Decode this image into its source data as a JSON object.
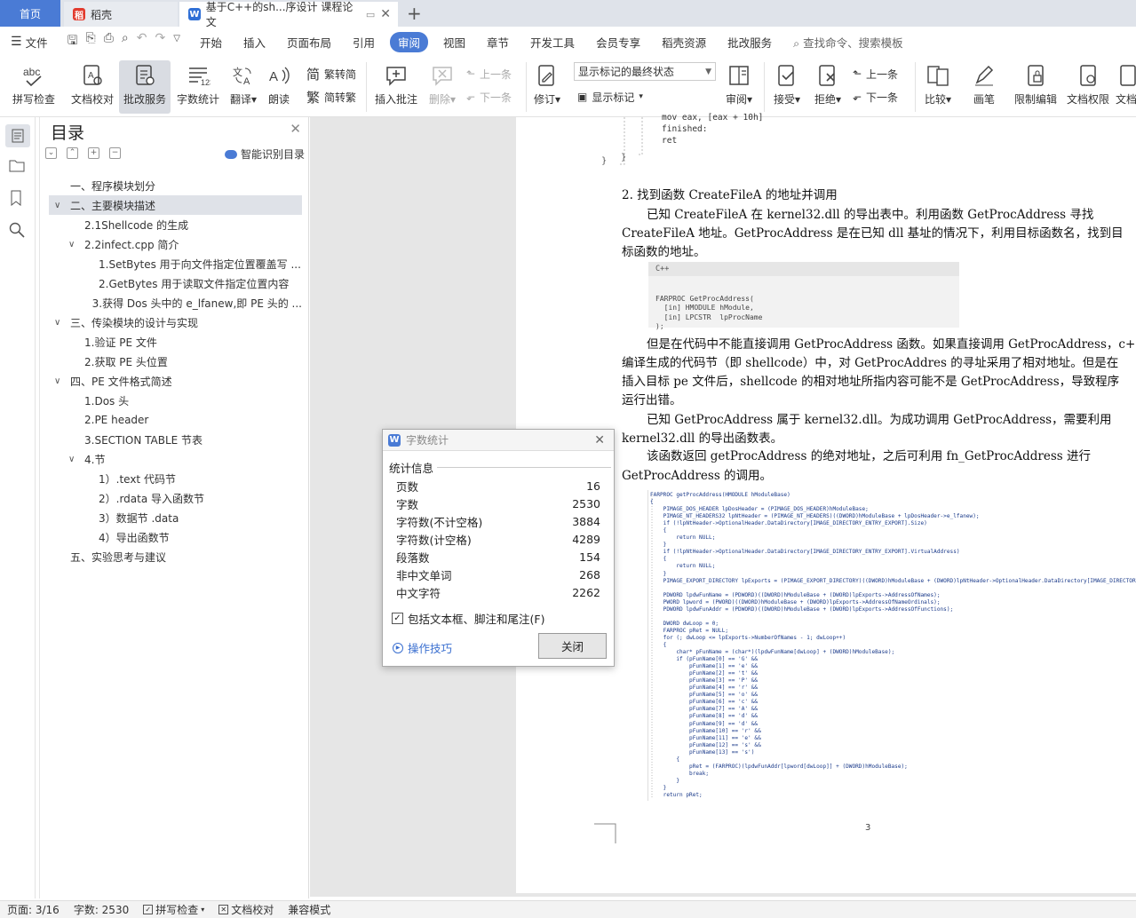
{
  "tabs": {
    "home": "首页",
    "daoke": "稻壳",
    "doc": "基于C++的sh...序设计 课程论文"
  },
  "menubar": {
    "file": "文件",
    "items": [
      "开始",
      "插入",
      "页面布局",
      "引用",
      "审阅",
      "视图",
      "章节",
      "开发工具",
      "会员专享",
      "稻壳资源",
      "批改服务"
    ],
    "search": "查找命令、搜索模板"
  },
  "ribbon": {
    "spell": "拼写检查",
    "proof": "文档校对",
    "correct": "批改服务",
    "wordcount": "字数统计",
    "translate": "翻译",
    "read": "朗读",
    "trad": "繁转简",
    "simp": "简转繁",
    "insert_comment": "插入批注",
    "delete": "删除",
    "prev": "上一条",
    "next": "下一条",
    "track": "修订",
    "markup_select": "显示标记的最终状态",
    "show_markup": "显示标记",
    "review": "审阅",
    "accept": "接受",
    "reject": "拒绝",
    "prev2": "上一条",
    "next2": "下一条",
    "compare": "比较",
    "pen": "画笔",
    "restrict": "限制编辑",
    "permission": "文档权限",
    "doc_more": "文档"
  },
  "toc": {
    "title": "目录",
    "smart": "智能识别目录",
    "items": [
      {
        "label": "一、程序模块划分",
        "level": 0
      },
      {
        "label": "二、主要模块描述",
        "level": 0
      },
      {
        "label": "2.1Shellcode 的生成",
        "level": 1
      },
      {
        "label": "2.2infect.cpp 简介",
        "level": 1
      },
      {
        "label": "1.SetBytes 用于向文件指定位置覆盖写 ...",
        "level": 2
      },
      {
        "label": "2.GetBytes 用于读取文件指定位置内容",
        "level": 2
      },
      {
        "label": "3.获得 Dos 头中的 e_lfanew,即 PE 头的 ...",
        "level": 2
      },
      {
        "label": "三、传染模块的设计与实现",
        "level": 0
      },
      {
        "label": "1.验证 PE 文件",
        "level": 1
      },
      {
        "label": "2.获取 PE 头位置",
        "level": 1
      },
      {
        "label": "四、PE 文件格式简述",
        "level": 0
      },
      {
        "label": "1.Dos 头",
        "level": 1
      },
      {
        "label": "2.PE header",
        "level": 1
      },
      {
        "label": "3.SECTION TABLE 节表",
        "level": 1
      },
      {
        "label": "4.节",
        "level": 1
      },
      {
        "label": "1）.text 代码节",
        "level": 2
      },
      {
        "label": "2）.rdata 导入函数节",
        "level": 2
      },
      {
        "label": "3）数据节 .data",
        "level": 2
      },
      {
        "label": "4）导出函数节",
        "level": 2
      },
      {
        "label": "五、实验思考与建议",
        "level": 0
      }
    ]
  },
  "document": {
    "code_top": [
      "mov eax, [eax + 10h]",
      "finished:",
      "ret"
    ],
    "heading2": "2.  找到函数 CreateFileA 的地址并调用",
    "p1": [
      "已知 CreateFileA 在 kernel32.dll 的导出表中。利用函数 GetProcAddress 寻找",
      "CreateFileA 地址。GetProcAddress 是在已知 dll 基址的情况下，利用目标函数名，找到目",
      "标函数的地址。"
    ],
    "code_lang": "C++",
    "code_block": [
      "FARPROC GetProcAddress(",
      "  [in] HMODULE hModule,",
      "  [in] LPCSTR  lpProcName",
      ");"
    ],
    "p2": [
      "但是在代码中不能直接调用 GetProcAddress 函数。如果直接调用 GetProcAddress，c++",
      "编译生成的代码节（即 shellcode）中，对 GetProcAddres 的寻址采用了相对地址。但是在",
      "插入目标 pe 文件后，shellcode 的相对地址所指内容可能不是 GetProcAddress，导致程序",
      "运行出错。"
    ],
    "p3": [
      "已知 GetProcAddress 属于 kernel32.dll。为成功调用 GetProcAddress，需要利用",
      "kernel32.dll 的导出函数表。"
    ],
    "p4": [
      "该函数返回 getProcAddress 的绝对地址，之后可利用 fn_GetProcAddress 进行",
      "GetProcAddress 的调用。"
    ],
    "code_img": [
      "FARPROC getProcAddress(HMODULE hModuleBase)",
      "{",
      "    PIMAGE_DOS_HEADER lpDosHeader = (PIMAGE_DOS_HEADER)hModuleBase;",
      "    PIMAGE_NT_HEADERS32 lpNtHeader = (PIMAGE_NT_HEADERS)((DWORD)hModuleBase + lpDosHeader->e_lfanew);",
      "    if (!lpNtHeader->OptionalHeader.DataDirectory[IMAGE_DIRECTORY_ENTRY_EXPORT].Size)",
      "    {",
      "        return NULL;",
      "    }",
      "    if (!lpNtHeader->OptionalHeader.DataDirectory[IMAGE_DIRECTORY_ENTRY_EXPORT].VirtualAddress)",
      "    {",
      "        return NULL;",
      "    }",
      "    PIMAGE_EXPORT_DIRECTORY lpExports = (PIMAGE_EXPORT_DIRECTORY)((DWORD)hModuleBase + (DWORD)lpNtHeader->OptionalHeader.DataDirectory[IMAGE_DIRECTORY_ENTRY_EXPORT].Vi",
      "",
      "    PDWORD lpdwFunName = (PDWORD)((DWORD)hModuleBase + (DWORD)lpExports->AddressOfNames);",
      "    PWORD lpword = (PWORD)((DWORD)hModuleBase + (DWORD)lpExports->AddressOfNameOrdinals);",
      "    PDWORD lpdwFunAddr = (PDWORD)((DWORD)hModuleBase + (DWORD)lpExports->AddressOfFunctions);",
      "",
      "    DWORD dwLoop = 0;",
      "    FARPROC pRet = NULL;",
      "    for (; dwLoop <= lpExports->NumberOfNames - 1; dwLoop++)",
      "    {",
      "        char* pFunName = (char*)(lpdwFunName[dwLoop] + (DWORD)hModuleBase);",
      "        if (pFunName[0] == 'G' &&",
      "            pFunName[1] == 'e' &&",
      "            pFunName[2] == 't' &&",
      "            pFunName[3] == 'P' &&",
      "            pFunName[4] == 'r' &&",
      "            pFunName[5] == 'o' &&",
      "            pFunName[6] == 'c' &&",
      "            pFunName[7] == 'A' &&",
      "            pFunName[8] == 'd' &&",
      "            pFunName[9] == 'd' &&",
      "            pFunName[10] == 'r' &&",
      "            pFunName[11] == 'e' &&",
      "            pFunName[12] == 's' &&",
      "            pFunName[13] == 's')",
      "        {",
      "            pRet = (FARPROC)(lpdwFunAddr[lpword[dwLoop]] + (DWORD)hModuleBase);",
      "            break;",
      "        }",
      "    }",
      "    return pRet;"
    ],
    "page_number": "3"
  },
  "dialog": {
    "title": "字数统计",
    "section": "统计信息",
    "rows": [
      {
        "label": "页数",
        "value": "16"
      },
      {
        "label": "字数",
        "value": "2530"
      },
      {
        "label": "字符数(不计空格)",
        "value": "3884"
      },
      {
        "label": "字符数(计空格)",
        "value": "4289"
      },
      {
        "label": "段落数",
        "value": "154"
      },
      {
        "label": "非中文单词",
        "value": "268"
      },
      {
        "label": "中文字符",
        "value": "2262"
      }
    ],
    "include_label": "包括文本框、脚注和尾注(F)",
    "tips": "操作技巧",
    "close": "关闭"
  },
  "status": {
    "page": "页面: 3/16",
    "words": "字数: 2530",
    "spell": "拼写检查",
    "proof": "文档校对",
    "compat": "兼容模式"
  }
}
